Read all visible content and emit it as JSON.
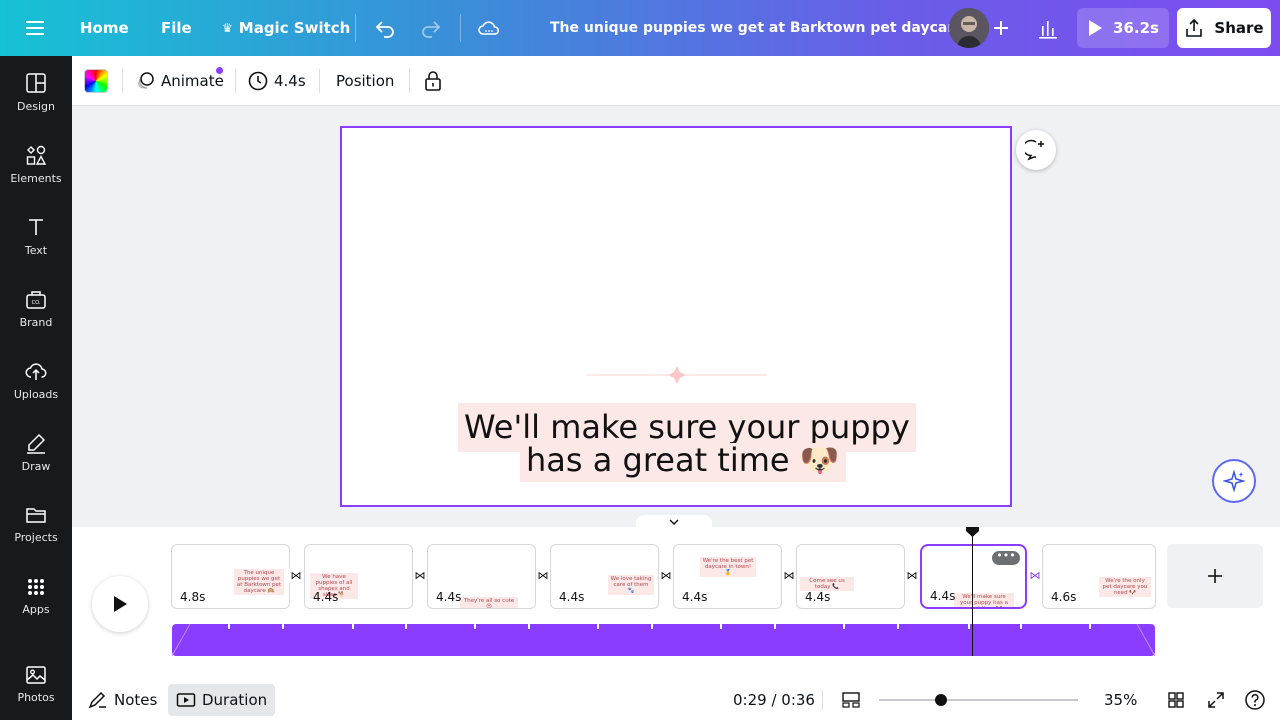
{
  "topbar": {
    "home": "Home",
    "file": "File",
    "magic_switch": "Magic Switch",
    "title": "The unique puppies we get at Barktown pet daycare 🙉",
    "play_duration": "36.2s",
    "share": "Share"
  },
  "sidebar": {
    "items": [
      {
        "label": "Design",
        "icon": "layout-icon"
      },
      {
        "label": "Elements",
        "icon": "shapes-icon"
      },
      {
        "label": "Text",
        "icon": "text-icon"
      },
      {
        "label": "Brand",
        "icon": "brand-icon"
      },
      {
        "label": "Uploads",
        "icon": "cloud-upload-icon"
      },
      {
        "label": "Draw",
        "icon": "pen-icon"
      },
      {
        "label": "Projects",
        "icon": "folder-icon"
      },
      {
        "label": "Apps",
        "icon": "grid-icon"
      },
      {
        "label": "Photos",
        "icon": "image-icon"
      }
    ]
  },
  "toolbar": {
    "animate": "Animate",
    "duration": "4.4s",
    "position": "Position"
  },
  "canvas": {
    "line1": "We'll make sure your puppy",
    "line2": "has a great time 🐶"
  },
  "timeline": {
    "clips": [
      {
        "duration": "4.8s",
        "text": "The unique puppies we get at Barktown pet daycare 🙉"
      },
      {
        "duration": "4.4s",
        "text": "We have puppies of all shapes and sizes 🐕"
      },
      {
        "duration": "4.4s",
        "text": "They're all so cute 😍"
      },
      {
        "duration": "4.4s",
        "text": "We love taking care of them 🐾"
      },
      {
        "duration": "4.4s",
        "text": "We're the best pet daycare in town! 🏅"
      },
      {
        "duration": "4.4s",
        "text": "Come see us today 📞"
      },
      {
        "duration": "4.4s",
        "text": "We'll make sure your puppy has a great time 🐶"
      },
      {
        "duration": "4.6s",
        "text": "We're the only pet daycare you need 🐶"
      }
    ]
  },
  "bottombar": {
    "notes": "Notes",
    "duration": "Duration",
    "time": "0:29 / 0:36",
    "zoom": "35%",
    "zoom_level": 0.35
  },
  "colors": {
    "accent": "#8b3dff",
    "caption_bg": "#fde8e8"
  }
}
